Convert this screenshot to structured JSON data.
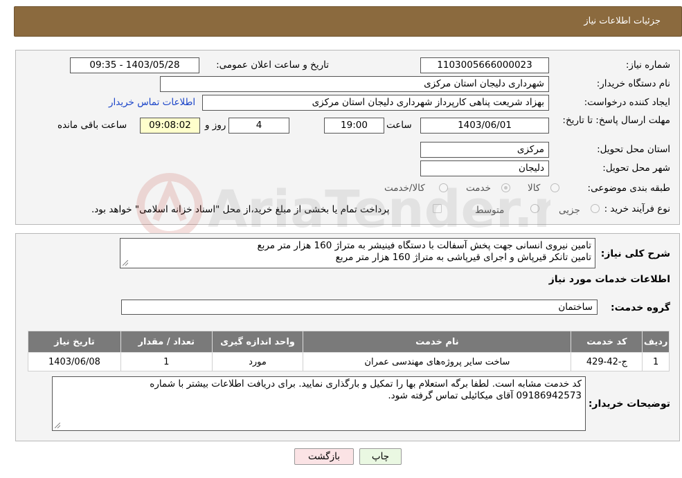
{
  "header": {
    "title": "جزئیات اطلاعات نیاز"
  },
  "form": {
    "need_number_label": "شماره نیاز:",
    "need_number": "1103005666000023",
    "announce_label": "تاریخ و ساعت اعلان عمومی:",
    "announce_value": "1403/05/28 - 09:35",
    "buyer_org_label": "نام دستگاه خریدار:",
    "buyer_org": "شهرداری دلیجان استان مرکزی",
    "requester_label": "ایجاد کننده درخواست:",
    "requester": "بهزاد شریعت پناهی کارپرداز شهرداری دلیجان استان مرکزی",
    "buyer_contact_link": "اطلاعات تماس خریدار",
    "deadline_label": "مهلت ارسال پاسخ: تا تاریخ:",
    "deadline_date": "1403/06/01",
    "time_label": "ساعت",
    "deadline_time": "19:00",
    "days_value": "4",
    "days_label": "روز و",
    "remaining_time": "09:08:02",
    "remaining_label": "ساعت باقی مانده",
    "province_label": "استان محل تحویل:",
    "province": "مرکزی",
    "city_label": "شهر محل تحویل:",
    "city": "دلیجان",
    "category_label": "طبقه بندی موضوعی:",
    "category_options": [
      {
        "label": "کالا",
        "checked": false
      },
      {
        "label": "خدمت",
        "checked": true
      },
      {
        "label": "کالا/خدمت",
        "checked": false
      }
    ],
    "process_label": "نوع فرآیند خرید :",
    "process_options": [
      {
        "label": "جزیی",
        "checked": false
      },
      {
        "label": "متوسط",
        "checked": false
      }
    ],
    "payment_checkbox_label": "پرداخت تمام یا بخشی از مبلغ خرید،از محل \"اسناد خزانه اسلامی\" خواهد بود."
  },
  "details": {
    "summary_label": "شرح کلی نیاز:",
    "summary_lines": [
      "تامین نیروی انسانی جهت پخش آسفالت با دستگاه فینیشر به متراژ 160 هزار متر مربع",
      "تامین تانکر قیرپاش و اجرای قیرپاشی به متراژ 160 هزار متر مربع"
    ],
    "services_info_title": "اطلاعات خدمات مورد نیاز",
    "service_group_label": "گروه خدمت:",
    "service_group": "ساختمان",
    "table": {
      "headers": [
        "ردیف",
        "کد خدمت",
        "نام خدمت",
        "واحد اندازه گیری",
        "تعداد / مقدار",
        "تاریخ نیاز"
      ],
      "rows": [
        [
          "1",
          "ج-42-429",
          "ساخت سایر پروژه‌های مهندسی عمران",
          "مورد",
          "1",
          "1403/06/08"
        ]
      ]
    },
    "buyer_notes_label": "توضیحات خریدار:",
    "buyer_notes_lines": [
      "کد خدمت مشابه است. لطفا برگه استعلام بها را تمکیل و بارگذاری نمایید. برای دریافت اطلاعات بیشتر با شماره",
      "09186942573 آقای میکائیلی تماس گرفته شود."
    ]
  },
  "buttons": {
    "print": "چاپ",
    "back": "بازگشت"
  },
  "watermark": {
    "text": "AriaTender.neT"
  }
}
